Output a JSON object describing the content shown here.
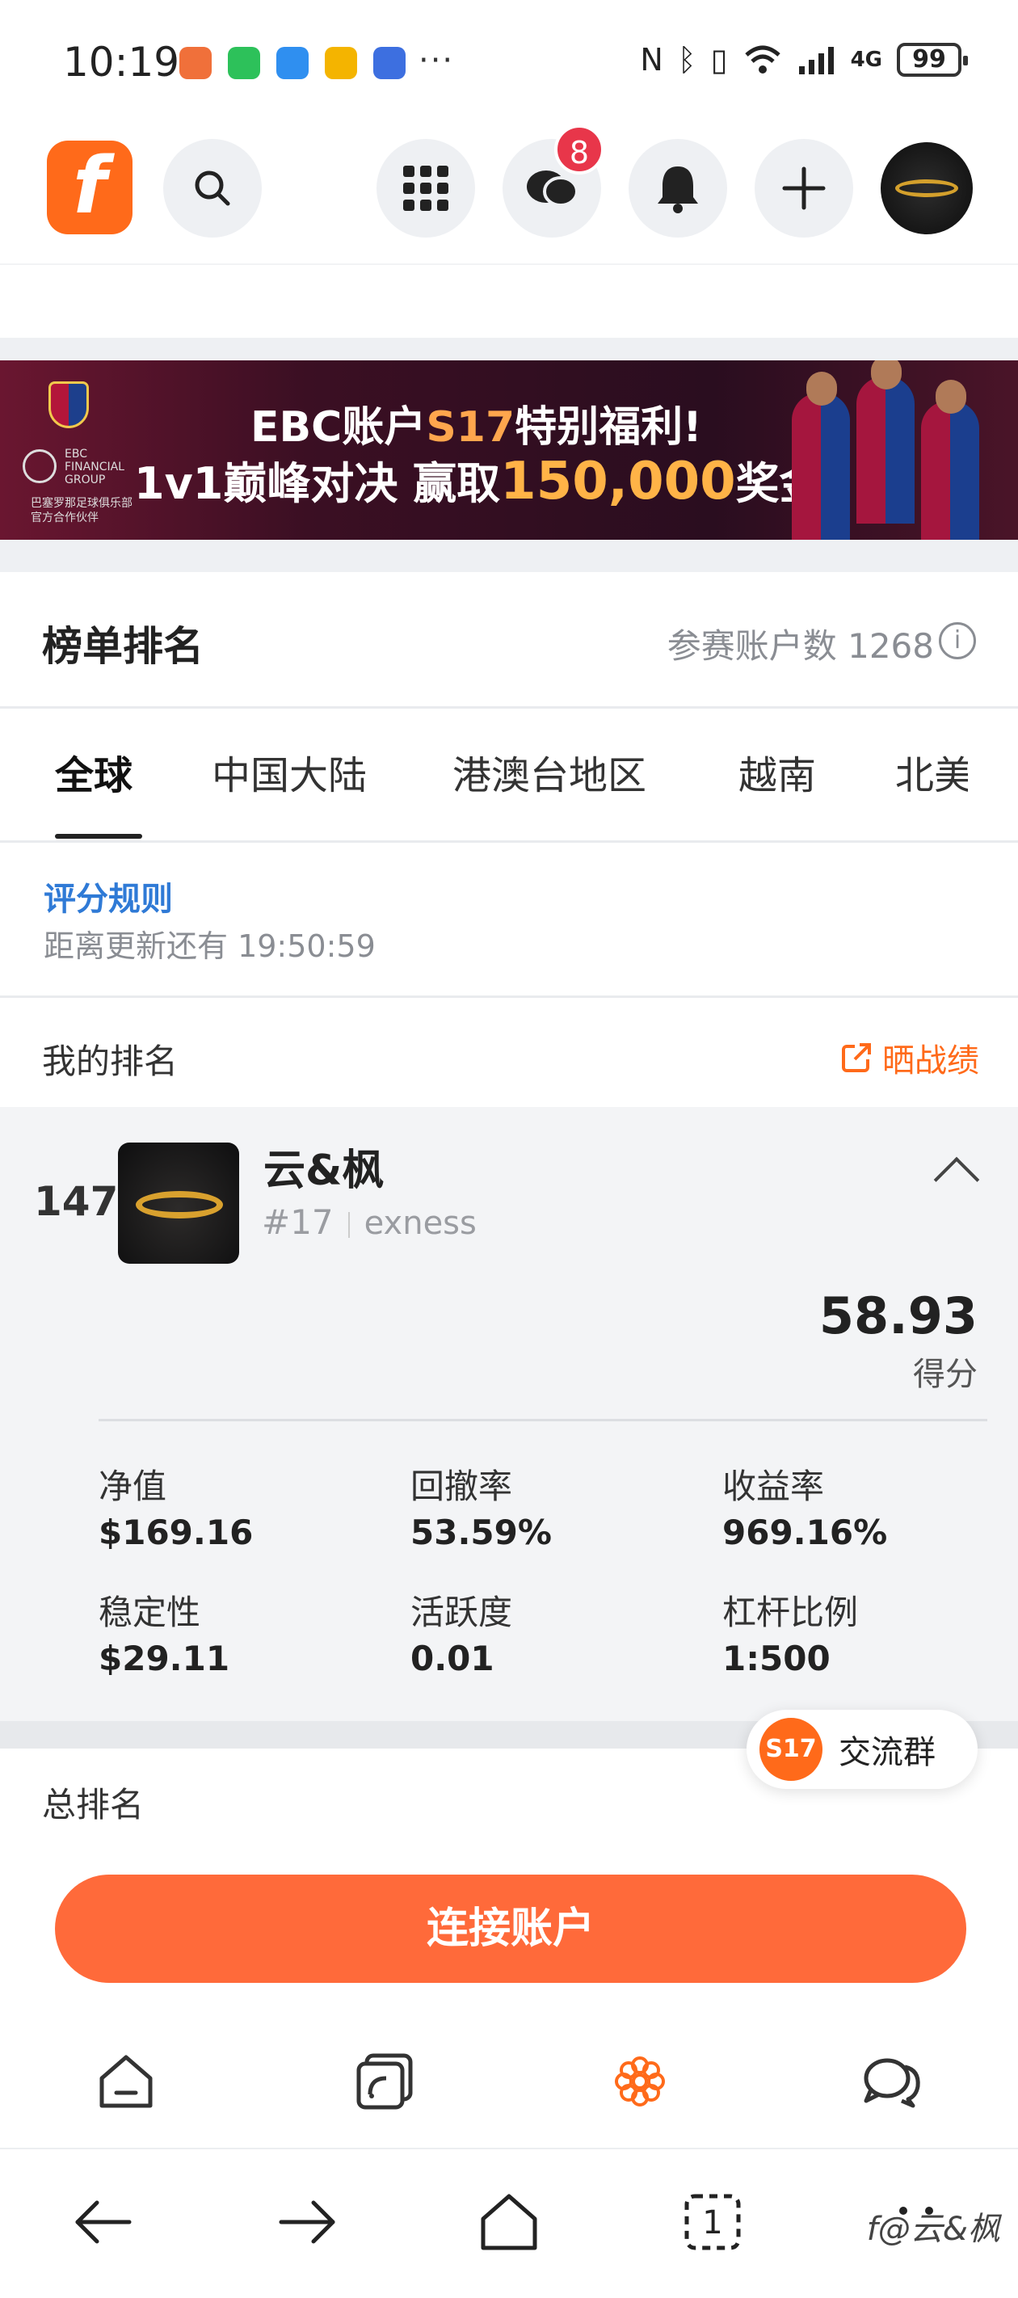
{
  "status_bar": {
    "time": "10:19",
    "battery": "99",
    "network": "4G"
  },
  "header": {
    "logo_letter": "f",
    "messages_badge": "8"
  },
  "banner": {
    "line1_prefix": "EBC账户",
    "line1_highlight": "S17",
    "line1_suffix": "特别福利!",
    "line2_prefix": "1v1巅峰对决  赢取",
    "line2_highlight": "150,000",
    "line2_suffix": "奖金!",
    "brand_text": "EBC FINANCIAL GROUP",
    "partner_text_1": "巴塞罗那足球俱乐部",
    "partner_text_2": "官方合作伙伴"
  },
  "ranking": {
    "title": "榜单排名",
    "participants_label": "参赛账户数 1268"
  },
  "tabs": [
    {
      "label": "全球"
    },
    {
      "label": "中国大陆"
    },
    {
      "label": "港澳台地区"
    },
    {
      "label": "越南"
    },
    {
      "label": "北美"
    }
  ],
  "rules": {
    "link": "评分规则",
    "countdown": "距离更新还有 19:50:59"
  },
  "my_rank": {
    "label": "我的排名",
    "share": "晒战绩",
    "rank": "147",
    "name": "云&枫",
    "tag": "#17",
    "broker": "exness",
    "score": "58.93",
    "score_label": "得分",
    "stats": [
      {
        "label": "净值",
        "value": "$169.16"
      },
      {
        "label": "回撤率",
        "value": "53.59%"
      },
      {
        "label": "收益率",
        "value": "969.16%"
      },
      {
        "label": "稳定性",
        "value": "$29.11"
      },
      {
        "label": "活跃度",
        "value": "0.01"
      },
      {
        "label": "杠杆比例",
        "value": "1:500"
      }
    ]
  },
  "total_rank_label": "总排名",
  "chat_group": {
    "badge": "S17",
    "label": "交流群"
  },
  "connect_button": "连接账户",
  "watermark": "f@云&枫",
  "colors": {
    "accent": "#ff6a1a",
    "link": "#2f7ad6",
    "badge": "#e8364a"
  }
}
